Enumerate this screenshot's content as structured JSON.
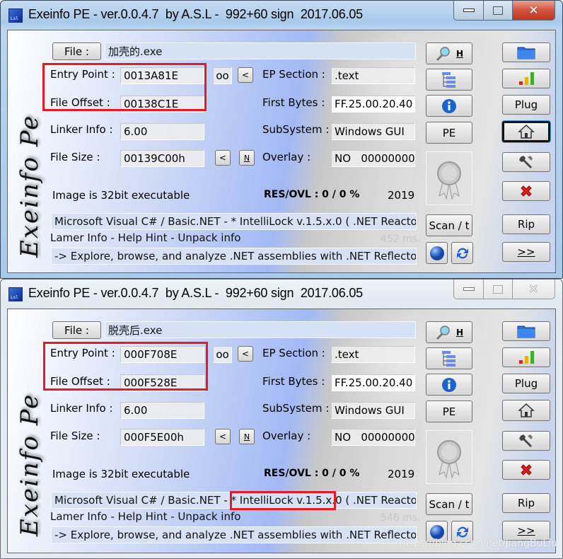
{
  "windows": [
    {
      "title": "Exeinfo PE - ver.0.0.4.7  by A.S.L -  992+60 sign  2017.06.05",
      "app_icon_text": "Lsl",
      "logo_text": "Exeinfo Pe",
      "file_button": "File :",
      "file_name": "加壳的.exe",
      "entry_point": {
        "label": "Entry Point :",
        "value": "0013A81E"
      },
      "file_offset": {
        "label": "File Offset :",
        "value": "00138C1E"
      },
      "linker_info": {
        "label": "Linker Info :",
        "value": "6.00"
      },
      "file_size": {
        "label": "File Size :",
        "value": "00139C00h"
      },
      "ep_section": {
        "label": "EP Section :",
        "value": ".text"
      },
      "first_bytes": {
        "label": "First Bytes :",
        "value": "FF.25.00.20.40"
      },
      "subsystem": {
        "label": "SubSystem :",
        "value": "Windows GUI"
      },
      "overlay": {
        "label": "Overlay :",
        "value": "NO   00000000"
      },
      "oo_button": "oo",
      "lt_button": "<",
      "n_button": "N",
      "image_info": "Image is 32bit executable",
      "res_ovl": "RES/OVL : 0 / 0 %",
      "year": "2019",
      "detection": "Microsoft Visual C# / Basic.NET - * IntelliLock v.1.5.x.0 ( .NET Reactor",
      "lamer_info": "Lamer Info - Help Hint - Unpack info",
      "timing": "452 ms.",
      "hint": "-> Explore, browse, and analyze .NET assemblies with .NET Reflector v",
      "buttons": {
        "h": "H",
        "pe": "PE",
        "plug": "Plug",
        "scan": "Scan / t",
        "rip": "Rip",
        "next": ">>"
      },
      "highlight_boxes": [
        "entry-point-and-file-offset"
      ]
    },
    {
      "title": "Exeinfo PE - ver.0.0.4.7  by A.S.L -  992+60 sign  2017.06.05",
      "app_icon_text": "Lsl",
      "logo_text": "Exeinfo Pe",
      "file_button": "File :",
      "file_name": "脱壳后.exe",
      "entry_point": {
        "label": "Entry Point :",
        "value": "000F708E"
      },
      "file_offset": {
        "label": "File Offset :",
        "value": "000F528E"
      },
      "linker_info": {
        "label": "Linker Info :",
        "value": "6.00"
      },
      "file_size": {
        "label": "File Size :",
        "value": "000F5E00h"
      },
      "ep_section": {
        "label": "EP Section :",
        "value": ".text"
      },
      "first_bytes": {
        "label": "First Bytes :",
        "value": "FF.25.00.20.40"
      },
      "subsystem": {
        "label": "SubSystem :",
        "value": "Windows GUI"
      },
      "overlay": {
        "label": "Overlay :",
        "value": "NO   00000000"
      },
      "oo_button": "oo",
      "lt_button": "<",
      "n_button": "N",
      "image_info": "Image is 32bit executable",
      "res_ovl": "RES/OVL : 0 / 0 %",
      "year": "2019",
      "detection": "Microsoft Visual C# / Basic.NET - * IntelliLock v.1.5.x.0 ( .NET Reactor",
      "lamer_info": "Lamer Info - Help Hint - Unpack info",
      "timing": "546 ms.",
      "hint": "-> Explore, browse, and analyze .NET assemblies with .NET Reflector v",
      "buttons": {
        "h": "H",
        "pe": "PE",
        "plug": "Plug",
        "scan": "Scan / t",
        "rip": "Rip",
        "next": ">>"
      },
      "highlight_boxes": [
        "entry-point-and-file-offset",
        "intellilock-version"
      ]
    }
  ],
  "watermark": "https://blog.csdn.net/JiangBuLiu",
  "colors": {
    "highlight_red": "#e21c24",
    "close_red": "#c0361f"
  }
}
